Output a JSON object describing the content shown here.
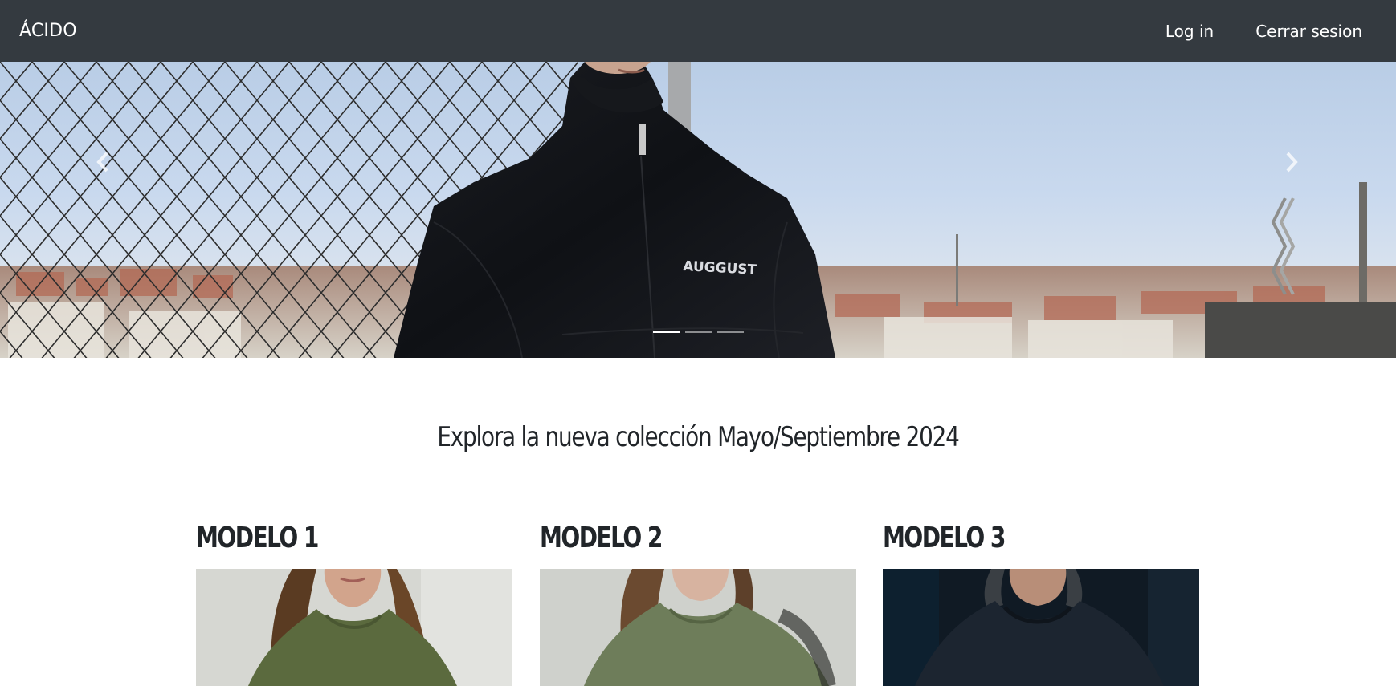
{
  "navbar": {
    "brand": "ÁCIDO",
    "links": [
      {
        "label": "Log in"
      },
      {
        "label": "Cerrar sesion"
      }
    ],
    "background": "#343a40"
  },
  "carousel": {
    "slide_count": 3,
    "active_index": 0,
    "jacket_print": "AUGGUST",
    "prev_icon": "chevron-left-icon",
    "next_icon": "chevron-right-icon"
  },
  "section": {
    "title": "Explora la nueva colección Mayo/Septiembre 2024"
  },
  "models": [
    {
      "title": "MODELO 1",
      "shirt_color": "#5b6a3e"
    },
    {
      "title": "MODELO 2",
      "shirt_color": "#6e7d5a"
    },
    {
      "title": "MODELO 3",
      "shirt_color": "#1c2530"
    }
  ]
}
